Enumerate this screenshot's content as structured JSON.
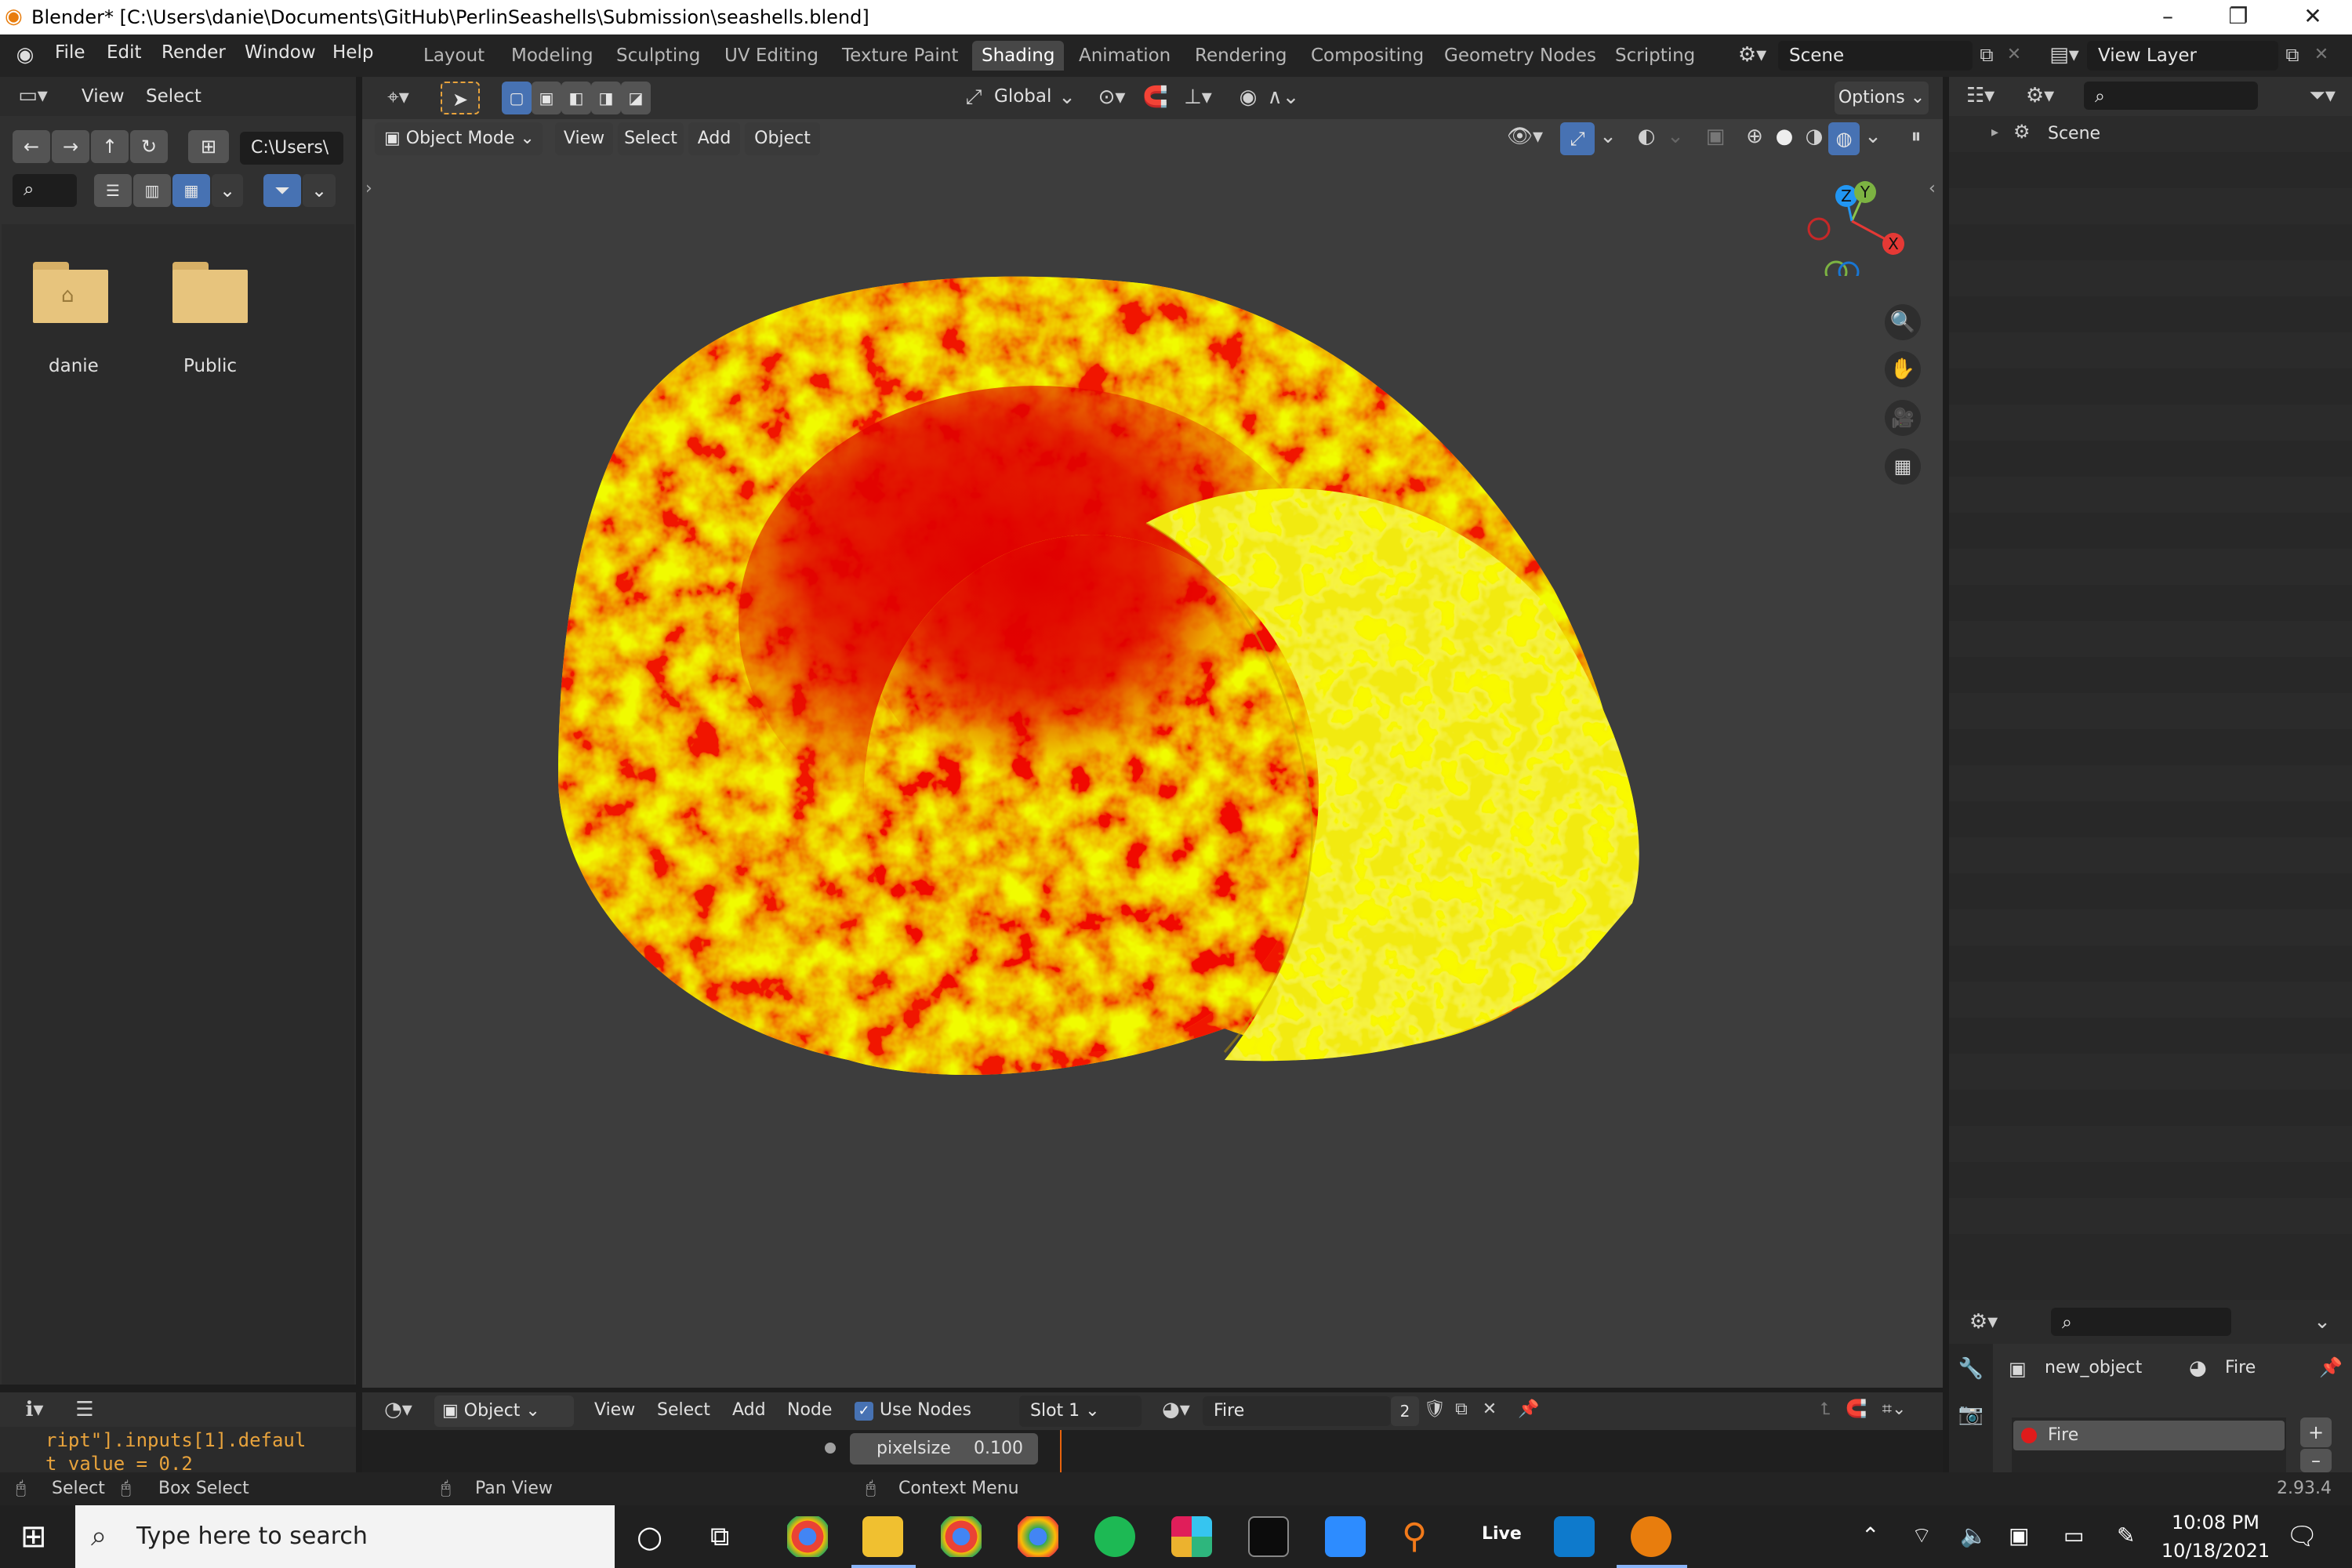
{
  "window": {
    "title": "Blender* [C:\\Users\\danie\\Documents\\GitHub\\PerlinSeashells\\Submission\\seashells.blend]"
  },
  "menu": [
    "File",
    "Edit",
    "Render",
    "Window",
    "Help"
  ],
  "workspaces": [
    "Layout",
    "Modeling",
    "Sculpting",
    "UV Editing",
    "Texture Paint",
    "Shading",
    "Animation",
    "Rendering",
    "Compositing",
    "Geometry Nodes",
    "Scripting"
  ],
  "active_workspace": "Shading",
  "scene": {
    "scene_name": "Scene",
    "view_layer": "View Layer"
  },
  "file_browser": {
    "header": {
      "view": "View",
      "select": "Select"
    },
    "path": "C:\\Users\\",
    "items": [
      {
        "name": "danie",
        "icon": "home-folder-icon"
      },
      {
        "name": "Public",
        "icon": "folder-icon"
      }
    ]
  },
  "viewport": {
    "header": {
      "transform_orientation": "Global",
      "options": "Options"
    },
    "mode": "Object Mode",
    "menus": [
      "View",
      "Select",
      "Add",
      "Object"
    ],
    "gizmo": {
      "x": "X",
      "y": "Y",
      "z": "Z"
    }
  },
  "outliner": {
    "items": [
      {
        "label": "Scene"
      }
    ]
  },
  "properties": {
    "object": "new_object",
    "material": "Fire",
    "slots": [
      {
        "label": "Fire",
        "color": "#e01b1b"
      }
    ]
  },
  "console": {
    "text_line1": "ript\"].inputs[1].defaul",
    "text_line2": "t_value = 0.2"
  },
  "node_editor": {
    "type": "Object",
    "menus": [
      "View",
      "Select",
      "Add",
      "Node"
    ],
    "use_nodes": "Use Nodes",
    "slot": "Slot 1",
    "material": "Fire",
    "users": "2",
    "pixelsize_label": "pixelsize",
    "pixelsize_value": "0.100"
  },
  "status_bar": {
    "select": "Select",
    "box_select": "Box Select",
    "pan_view": "Pan View",
    "context_menu": "Context Menu",
    "version": "2.93.4"
  },
  "taskbar": {
    "search_placeholder": "Type here to search",
    "time": "10:08 PM",
    "date": "10/18/2021"
  },
  "colors": {
    "accent": "#4772b3",
    "active_tab": "#474747",
    "blender_orange": "#e87d0d"
  }
}
